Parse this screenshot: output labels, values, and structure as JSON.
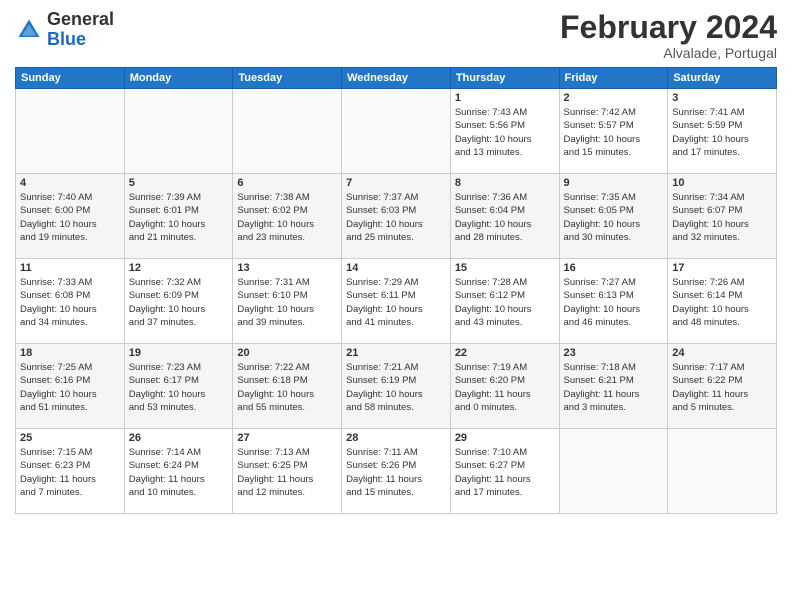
{
  "header": {
    "logo_general": "General",
    "logo_blue": "Blue",
    "month_title": "February 2024",
    "location": "Alvalade, Portugal"
  },
  "days_of_week": [
    "Sunday",
    "Monday",
    "Tuesday",
    "Wednesday",
    "Thursday",
    "Friday",
    "Saturday"
  ],
  "weeks": [
    [
      {
        "day": "",
        "info": ""
      },
      {
        "day": "",
        "info": ""
      },
      {
        "day": "",
        "info": ""
      },
      {
        "day": "",
        "info": ""
      },
      {
        "day": "1",
        "info": "Sunrise: 7:43 AM\nSunset: 5:56 PM\nDaylight: 10 hours\nand 13 minutes."
      },
      {
        "day": "2",
        "info": "Sunrise: 7:42 AM\nSunset: 5:57 PM\nDaylight: 10 hours\nand 15 minutes."
      },
      {
        "day": "3",
        "info": "Sunrise: 7:41 AM\nSunset: 5:59 PM\nDaylight: 10 hours\nand 17 minutes."
      }
    ],
    [
      {
        "day": "4",
        "info": "Sunrise: 7:40 AM\nSunset: 6:00 PM\nDaylight: 10 hours\nand 19 minutes."
      },
      {
        "day": "5",
        "info": "Sunrise: 7:39 AM\nSunset: 6:01 PM\nDaylight: 10 hours\nand 21 minutes."
      },
      {
        "day": "6",
        "info": "Sunrise: 7:38 AM\nSunset: 6:02 PM\nDaylight: 10 hours\nand 23 minutes."
      },
      {
        "day": "7",
        "info": "Sunrise: 7:37 AM\nSunset: 6:03 PM\nDaylight: 10 hours\nand 25 minutes."
      },
      {
        "day": "8",
        "info": "Sunrise: 7:36 AM\nSunset: 6:04 PM\nDaylight: 10 hours\nand 28 minutes."
      },
      {
        "day": "9",
        "info": "Sunrise: 7:35 AM\nSunset: 6:05 PM\nDaylight: 10 hours\nand 30 minutes."
      },
      {
        "day": "10",
        "info": "Sunrise: 7:34 AM\nSunset: 6:07 PM\nDaylight: 10 hours\nand 32 minutes."
      }
    ],
    [
      {
        "day": "11",
        "info": "Sunrise: 7:33 AM\nSunset: 6:08 PM\nDaylight: 10 hours\nand 34 minutes."
      },
      {
        "day": "12",
        "info": "Sunrise: 7:32 AM\nSunset: 6:09 PM\nDaylight: 10 hours\nand 37 minutes."
      },
      {
        "day": "13",
        "info": "Sunrise: 7:31 AM\nSunset: 6:10 PM\nDaylight: 10 hours\nand 39 minutes."
      },
      {
        "day": "14",
        "info": "Sunrise: 7:29 AM\nSunset: 6:11 PM\nDaylight: 10 hours\nand 41 minutes."
      },
      {
        "day": "15",
        "info": "Sunrise: 7:28 AM\nSunset: 6:12 PM\nDaylight: 10 hours\nand 43 minutes."
      },
      {
        "day": "16",
        "info": "Sunrise: 7:27 AM\nSunset: 6:13 PM\nDaylight: 10 hours\nand 46 minutes."
      },
      {
        "day": "17",
        "info": "Sunrise: 7:26 AM\nSunset: 6:14 PM\nDaylight: 10 hours\nand 48 minutes."
      }
    ],
    [
      {
        "day": "18",
        "info": "Sunrise: 7:25 AM\nSunset: 6:16 PM\nDaylight: 10 hours\nand 51 minutes."
      },
      {
        "day": "19",
        "info": "Sunrise: 7:23 AM\nSunset: 6:17 PM\nDaylight: 10 hours\nand 53 minutes."
      },
      {
        "day": "20",
        "info": "Sunrise: 7:22 AM\nSunset: 6:18 PM\nDaylight: 10 hours\nand 55 minutes."
      },
      {
        "day": "21",
        "info": "Sunrise: 7:21 AM\nSunset: 6:19 PM\nDaylight: 10 hours\nand 58 minutes."
      },
      {
        "day": "22",
        "info": "Sunrise: 7:19 AM\nSunset: 6:20 PM\nDaylight: 11 hours\nand 0 minutes."
      },
      {
        "day": "23",
        "info": "Sunrise: 7:18 AM\nSunset: 6:21 PM\nDaylight: 11 hours\nand 3 minutes."
      },
      {
        "day": "24",
        "info": "Sunrise: 7:17 AM\nSunset: 6:22 PM\nDaylight: 11 hours\nand 5 minutes."
      }
    ],
    [
      {
        "day": "25",
        "info": "Sunrise: 7:15 AM\nSunset: 6:23 PM\nDaylight: 11 hours\nand 7 minutes."
      },
      {
        "day": "26",
        "info": "Sunrise: 7:14 AM\nSunset: 6:24 PM\nDaylight: 11 hours\nand 10 minutes."
      },
      {
        "day": "27",
        "info": "Sunrise: 7:13 AM\nSunset: 6:25 PM\nDaylight: 11 hours\nand 12 minutes."
      },
      {
        "day": "28",
        "info": "Sunrise: 7:11 AM\nSunset: 6:26 PM\nDaylight: 11 hours\nand 15 minutes."
      },
      {
        "day": "29",
        "info": "Sunrise: 7:10 AM\nSunset: 6:27 PM\nDaylight: 11 hours\nand 17 minutes."
      },
      {
        "day": "",
        "info": ""
      },
      {
        "day": "",
        "info": ""
      }
    ]
  ]
}
